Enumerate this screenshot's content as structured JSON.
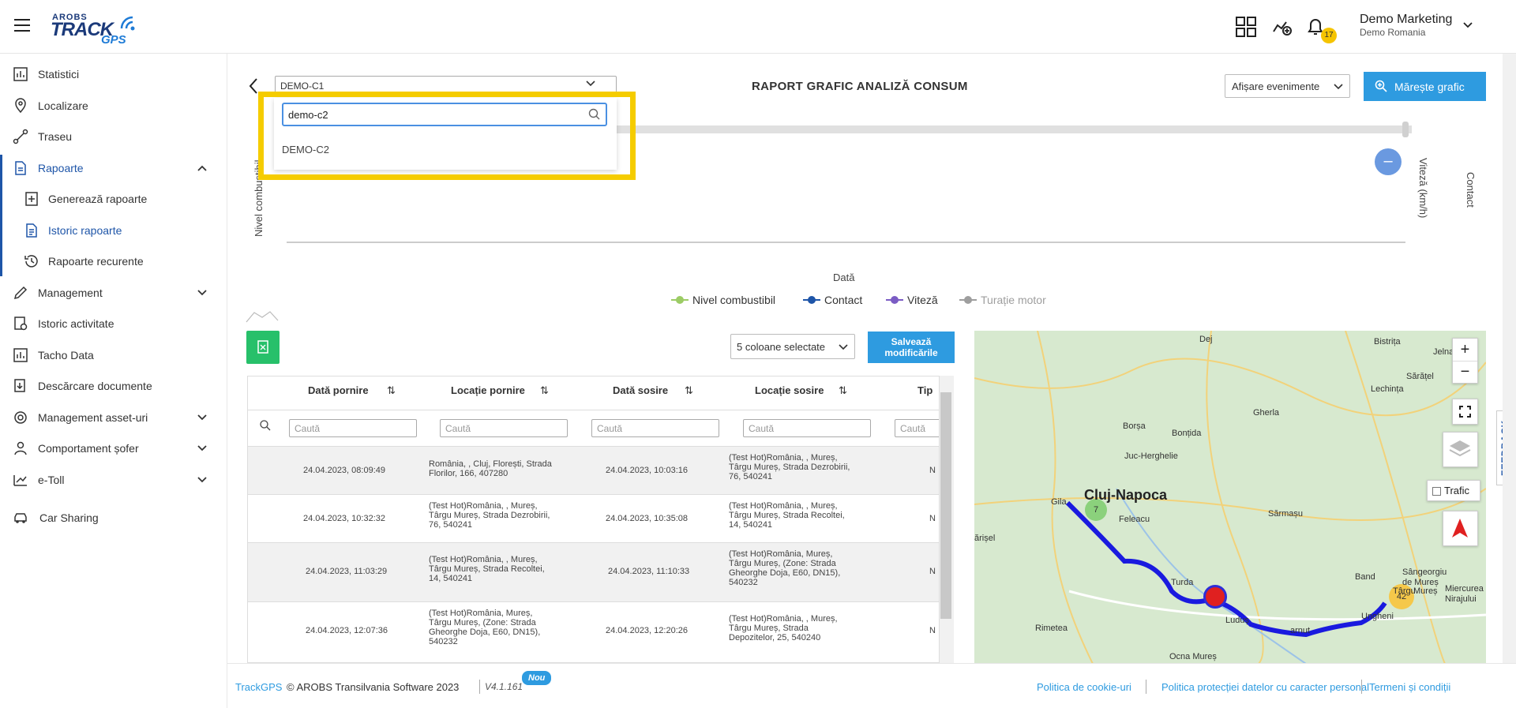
{
  "header": {
    "logo_top": "AROBS",
    "logo_main": "TRACK",
    "logo_sub": "GPS",
    "notification_count": "17",
    "user_name": "Demo Marketing",
    "user_org": "Demo Romania"
  },
  "sidebar": {
    "items": [
      {
        "label": "Statistici"
      },
      {
        "label": "Localizare"
      },
      {
        "label": "Traseu"
      },
      {
        "label": "Rapoarte"
      },
      {
        "label": "Generează rapoarte"
      },
      {
        "label": "Istoric rapoarte"
      },
      {
        "label": "Rapoarte recurente"
      },
      {
        "label": "Management"
      },
      {
        "label": "Istoric activitate"
      },
      {
        "label": "Tacho Data"
      },
      {
        "label": "Descărcare documente"
      },
      {
        "label": "Management asset-uri"
      },
      {
        "label": "Comportament șofer"
      },
      {
        "label": "e-Toll"
      },
      {
        "label": "Car Sharing"
      }
    ]
  },
  "report": {
    "vehicle_selected": "DEMO-C1",
    "title": "RAPORT GRAFIC ANALIZĂ CONSUM",
    "events_select": "Afișare evenimente",
    "enlarge_label": "Mărește grafic"
  },
  "dropdown": {
    "search_value": "demo-c2",
    "options": [
      "DEMO-C2"
    ]
  },
  "chart": {
    "y_left_label": "Nivel combustibil",
    "y_right_label_1": "Viteză (km/h)",
    "y_right_label_2": "Contact",
    "x_label": "Dată",
    "legend": [
      {
        "name": "Nivel combustibil",
        "color": "#9ccc65"
      },
      {
        "name": "Contact",
        "color": "#1e55a8"
      },
      {
        "name": "Viteză",
        "color": "#7b5cc4"
      },
      {
        "name": "Turație motor",
        "color": "#9e9e9e"
      }
    ]
  },
  "table": {
    "columns_select": "5 coloane selectate",
    "save_label_1": "Salvează",
    "save_label_2": "modificările",
    "headers": [
      "Dată pornire",
      "Locație pornire",
      "Dată sosire",
      "Locație sosire",
      "Tip"
    ],
    "filter_placeholder": "Caută",
    "rows": [
      {
        "start": "24.04.2023, 08:09:49",
        "start_loc": [
          "România, , Cluj, Florești, Strada",
          "Florilor, 166, 407280"
        ],
        "end": "24.04.2023, 10:03:16",
        "end_loc": [
          "(Test Hot)România, , Mureș,",
          "Târgu Mureș, Strada Dezrobirii,",
          "76, 540241"
        ],
        "type": "N"
      },
      {
        "start": "24.04.2023, 10:32:32",
        "start_loc": [
          "(Test Hot)România, , Mureș,",
          "Târgu Mureș, Strada Dezrobirii,",
          "76, 540241"
        ],
        "end": "24.04.2023, 10:35:08",
        "end_loc": [
          "(Test Hot)România, , Mureș,",
          "Târgu Mureș, Strada Recoltei,",
          "14, 540241"
        ],
        "type": "N"
      },
      {
        "start": "24.04.2023, 11:03:29",
        "start_loc": [
          "(Test Hot)România, , Mureș,",
          "Târgu Mureș, Strada Recoltei,",
          "14, 540241"
        ],
        "end": "24.04.2023, 11:10:33",
        "end_loc": [
          "(Test Hot)România, Mureș,",
          "Târgu Mureș, (Zone: Strada",
          "Gheorghe Doja, E60, DN15),",
          "540232"
        ],
        "type": "N"
      },
      {
        "start": "24.04.2023, 12:07:36",
        "start_loc": [
          "(Test Hot)România, Mureș,",
          "Târgu Mureș, (Zone: Strada",
          "Gheorghe Doja, E60, DN15),",
          "540232"
        ],
        "end": "24.04.2023, 12:20:26",
        "end_loc": [
          "(Test Hot)România, , Mureș,",
          "Târgu Mureș, Strada",
          "Depozitelor, 25, 540240"
        ],
        "type": "N"
      }
    ]
  },
  "map": {
    "traffic_label": "Trafic",
    "cluster_1": "7",
    "cluster_2": "42",
    "cities": {
      "dej": "Dej",
      "bistrita": "Bistrița",
      "jelna": "Jelna",
      "sarata": "Sărățel",
      "lechinta": "Lechința",
      "gherla": "Gherla",
      "borsa": "Borșa",
      "bontida": "Bonțida",
      "juc": "Juc-Herghelie",
      "cluj": "Cluj-Napoca",
      "gilau": "Gila",
      "feleacu": "Feleacu",
      "sarmasu": "Sărmașu",
      "sarisel": "ărișel",
      "turda": "Turda",
      "band": "Band",
      "sangeorgiu": "Sângeorgiu",
      "demures": "de Mureș",
      "targu": "Târgu",
      "mures": "Mureș",
      "miercurea": "Miercurea",
      "nirajului": "Nirajului",
      "rimetea": "Rimetea",
      "ludus": "Luduș",
      "ungheni": "Ungheni",
      "ocna": "Ocna Mureș",
      "arnut": "arnut"
    }
  },
  "footer": {
    "brand": "TrackGPS",
    "copyright": "© AROBS Transilvania Software 2023",
    "version": "V4.1.161",
    "new_badge": "Nou",
    "link_cookie": "Politica de cookie-uri",
    "link_privacy": "Politica protecției datelor cu caracter personal",
    "link_terms": "Termeni și condiții"
  },
  "feedback": "FEEDBACK"
}
